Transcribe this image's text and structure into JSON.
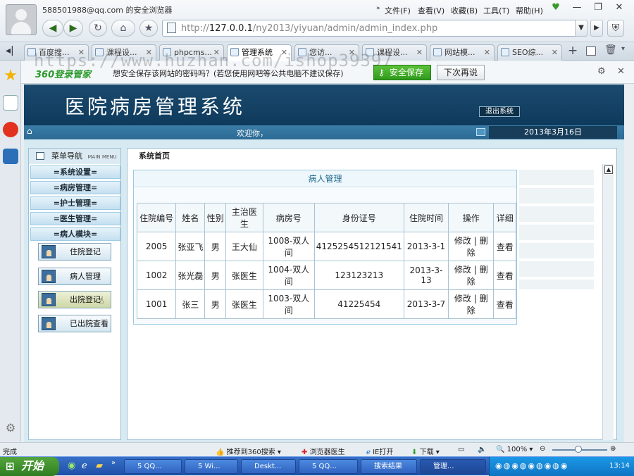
{
  "browser": {
    "user_email": "588501988@qq.com 的安全浏览器",
    "menu": [
      "文件(F)",
      "查看(V)",
      "收藏(B)",
      "工具(T)",
      "帮助(H)"
    ],
    "url_host": "127.0.0.1",
    "url_prefix": "http://",
    "url_path": "/ny2013/yiyuan/admin/admin_index.php",
    "tabs": [
      {
        "label": "百度搜..."
      },
      {
        "label": "课程设..."
      },
      {
        "label": "phpcms..."
      },
      {
        "label": "管理系统",
        "active": true
      },
      {
        "label": "您访..."
      },
      {
        "label": "课程设..."
      },
      {
        "label": "网站模..."
      },
      {
        "label": "SEO综..."
      }
    ],
    "pwbar": {
      "brand": "360登录管家",
      "prompt": "想安全保存该网站的密码吗？(若您使用网吧等公共电脑不建议保存)",
      "save": "安全保存",
      "later": "下次再说"
    }
  },
  "app": {
    "title": "医院病房管理系统",
    "logout": "退出系统",
    "welcome": "欢迎你，",
    "date": "2013年3月16日",
    "menu_title": "菜单导航",
    "menu_title_en": "MAIN MENU",
    "sections": [
      "=系统设置=",
      "=病房管理=",
      "=护士管理=",
      "=医生管理=",
      "=病人模块="
    ],
    "sub_buttons": [
      "住院登记",
      "病人管理",
      "出院登记",
      "已出院查看"
    ],
    "content_title": "系统首页",
    "panel_title": "病人管理",
    "table": {
      "headers": [
        "住院编号",
        "姓名",
        "性别",
        "主治医生",
        "病房号",
        "身份证号",
        "住院时间",
        "操作",
        "详细"
      ],
      "rows": [
        [
          "2005",
          "张亚飞",
          "男",
          "王大仙",
          "1008-双人间",
          "4125254512121541",
          "2013-3-1",
          "修改 | 删除",
          "查看"
        ],
        [
          "1002",
          "张光磊",
          "男",
          "张医生",
          "1004-双人间",
          "123123213",
          "2013-3-13",
          "修改 | 删除",
          "查看"
        ],
        [
          "1001",
          "张三",
          "男",
          "张医生",
          "1003-双人间",
          "41225454",
          "2013-3-7",
          "修改 | 删除",
          "查看"
        ]
      ]
    }
  },
  "status": {
    "left": "完成",
    "items": [
      "推荐到360搜索",
      "浏览器医生",
      "IE打开",
      "下载",
      "100%"
    ]
  },
  "taskbar": {
    "start": "开始",
    "tasks": [
      "5 QQ...",
      "5 Wi...",
      "Deskt...",
      "5 QQ...",
      "搜索结果",
      "管理..."
    ],
    "clock": "13:14"
  },
  "watermark": "https://www.huzhan.com/ishop39397"
}
